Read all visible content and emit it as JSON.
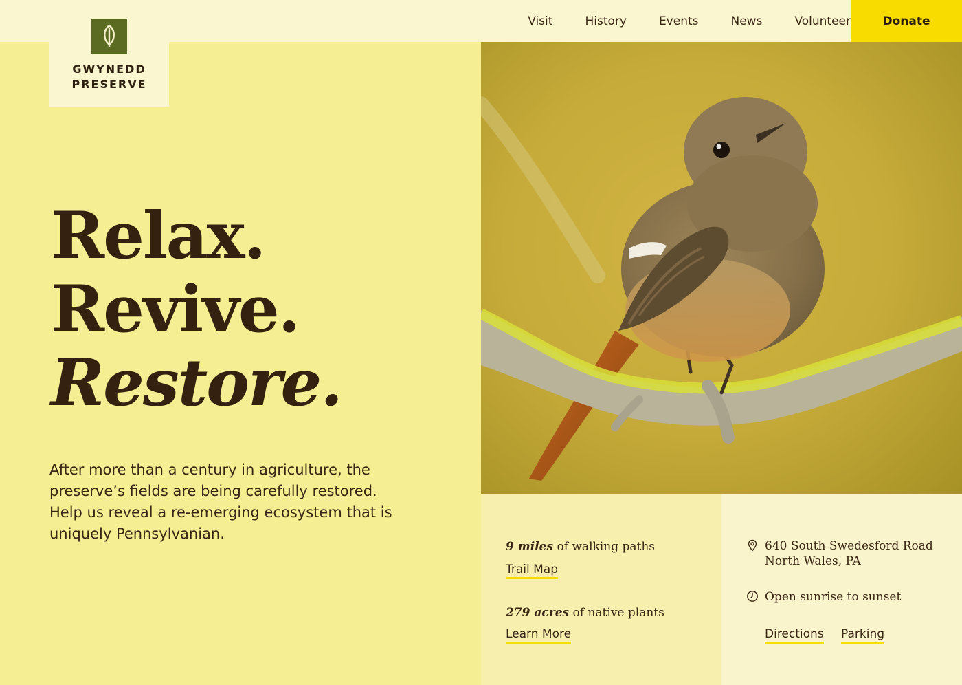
{
  "brand": {
    "line1": "GWYNEDD",
    "line2": "PRESERVE",
    "mark_icon": "leaf-icon",
    "mark_color": "#5b6b22"
  },
  "nav": {
    "items": [
      "Visit",
      "History",
      "Events",
      "News",
      "Volunteer"
    ],
    "donate_label": "Donate",
    "donate_color": "#f8dc00"
  },
  "hero": {
    "line1": "Relax.",
    "line2": "Revive.",
    "line3": "Restore.",
    "intro": "After more than a century in agriculture, the preserve’s fields are being carefully restored. Help us reveal a re-emerging ecosystem that is uniquely Pennsylvanian.",
    "image_icon": "bird-on-branch-photo"
  },
  "stats": {
    "paths_value": "9 miles",
    "paths_text": "of walking paths",
    "trail_link": "Trail Map",
    "plants_value": "279 acres",
    "plants_text": "of native plants",
    "learn_link": "Learn More"
  },
  "visit": {
    "address_line1": "640 South Swedesford Road",
    "address_line2": "North Wales, PA",
    "address_icon": "map-pin-icon",
    "hours": "Open sunrise to sunset",
    "hours_icon": "clock-icon",
    "directions_link": "Directions",
    "parking_link": "Parking"
  },
  "colors": {
    "background": "#f5ee92",
    "topbar": "#faf6cf",
    "text": "#3a2614",
    "accent": "#f8dc00"
  }
}
